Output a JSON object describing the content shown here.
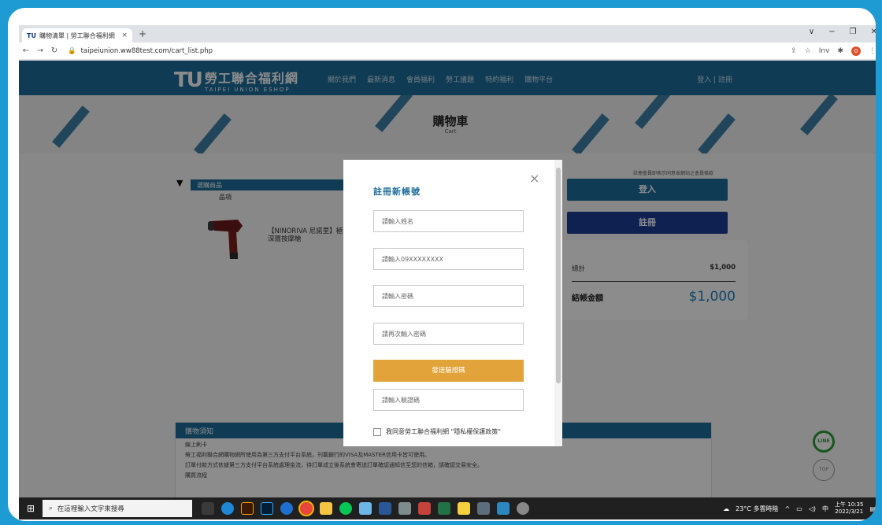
{
  "browser": {
    "tab_title": "購物清單 | 勞工聯合福利網",
    "tab_favicon": "TU",
    "tab_close": "×",
    "new_tab": "+",
    "url": "taipeiunion.ww88test.com/cart_list.php",
    "profile_initial": "0",
    "extension_label": "Inv",
    "window_controls": [
      "∨",
      "−",
      "❐",
      "✕"
    ]
  },
  "site": {
    "logo_mark": "TU",
    "logo_cn": "勞工聯合福利網",
    "logo_en": "TAIPEI UNION ESHOP",
    "menu": [
      "關於我們",
      "最新消息",
      "會員福利",
      "勞工議題",
      "特約福利",
      "購物平台"
    ],
    "login_link": "登入 | 註冊"
  },
  "cart": {
    "title": "購物車",
    "subtitle": "Cart",
    "section_header": "選購商品",
    "column_label": "品項",
    "product_name": "【NINORIVA 尼諾里】極致深層按摩槍",
    "terms_note": "註冊會員即表示同意本網站之會員條款",
    "login_button": "登入",
    "register_button": "註冊",
    "subtotal_label": "總計",
    "subtotal_value": "$1,000",
    "total_label": "結帳金額",
    "total_value": "$1,000"
  },
  "notice": {
    "header": "購物須知",
    "lines": [
      "線上刷卡",
      "勞工福利聯合網購物網所使用為第三方支付平台系統，刊載銀行的VISA及MASTER信用卡皆可使用。",
      "訂單付款方式依據第三方支付平台系統處理金流，待訂單成立後系統會寄送訂單確認通知信至您的信箱，請確認交易安全。",
      "購買流程"
    ]
  },
  "modal": {
    "close": "×",
    "title": "註冊新帳號",
    "name_placeholder": "請輸入姓名",
    "phone_placeholder": "請輸入09XXXXXXXX",
    "password_placeholder": "請輸入密碼",
    "password_confirm_placeholder": "請再次輸入密碼",
    "send_code_button": "發送驗證碼",
    "code_placeholder": "請輸入驗證碼",
    "agree_text": "我同意勞工聯合福利網 \"隱私權保護政策\""
  },
  "float_icons": {
    "line": "LINE",
    "top": "TOP"
  },
  "taskbar": {
    "start_icon": "⊞",
    "search_placeholder": "在這裡輸入文字來搜尋",
    "weather": "23°C 多雲時陰",
    "ime": "中",
    "time": "上午 10:35",
    "date": "2022/3/21"
  },
  "colors": {
    "desktop": "#1f9bd3",
    "brand_blue": "#1c6c9a",
    "register_blue": "#1b3d93",
    "send_button": "#e2a33a",
    "price_blue": "#1e7fc0"
  }
}
